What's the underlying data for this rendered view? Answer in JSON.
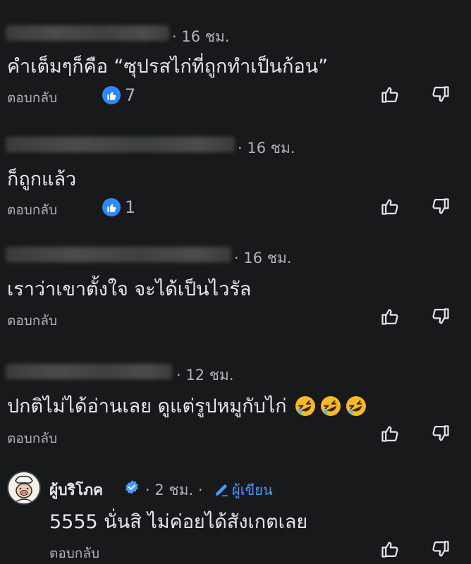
{
  "comments": [
    {
      "time": "· 16 ชม.",
      "text": "คำเต็มๆก็คือ “ซุปรสไก่ที่ถูกทำเป็นก้อน”",
      "reply": "ตอบกลับ",
      "like_count": "7"
    },
    {
      "time": "· 16 ชม.",
      "text": "ก็ถูกแล้ว",
      "reply": "ตอบกลับ",
      "like_count": "1"
    },
    {
      "time": "· 16 ชม.",
      "text": "เราว่าเขาตั้งใจ จะได้เป็นไวรัล",
      "reply": "ตอบกลับ"
    },
    {
      "time": "· 12 ชม.",
      "text": "ปกติไม่ได้อ่านเลย ดูแต่รูปหมูกับไก่",
      "reply": "ตอบกลับ",
      "emojis": [
        "rolling-laughing-emoji",
        "rolling-laughing-emoji",
        "rolling-laughing-emoji"
      ]
    }
  ],
  "author_reply": {
    "author": "ผู้บริโภค",
    "time": "· 2 ชม. ·",
    "writer_label": "ผู้เขียน",
    "text": "5555 นั่นสิ ไม่ค่อยได้สังเกตเลย",
    "reply": "ตอบกลับ"
  },
  "colors": {
    "background": "#18191a",
    "text": "#e4e6eb",
    "secondary": "#b0b3b8",
    "like_blue": "#2e89ff",
    "verified_blue": "#4599ff"
  },
  "icons": [
    "like-icon",
    "thumbs-up-icon",
    "thumbs-down-icon",
    "verified-icon",
    "pen-icon",
    "avatar"
  ]
}
